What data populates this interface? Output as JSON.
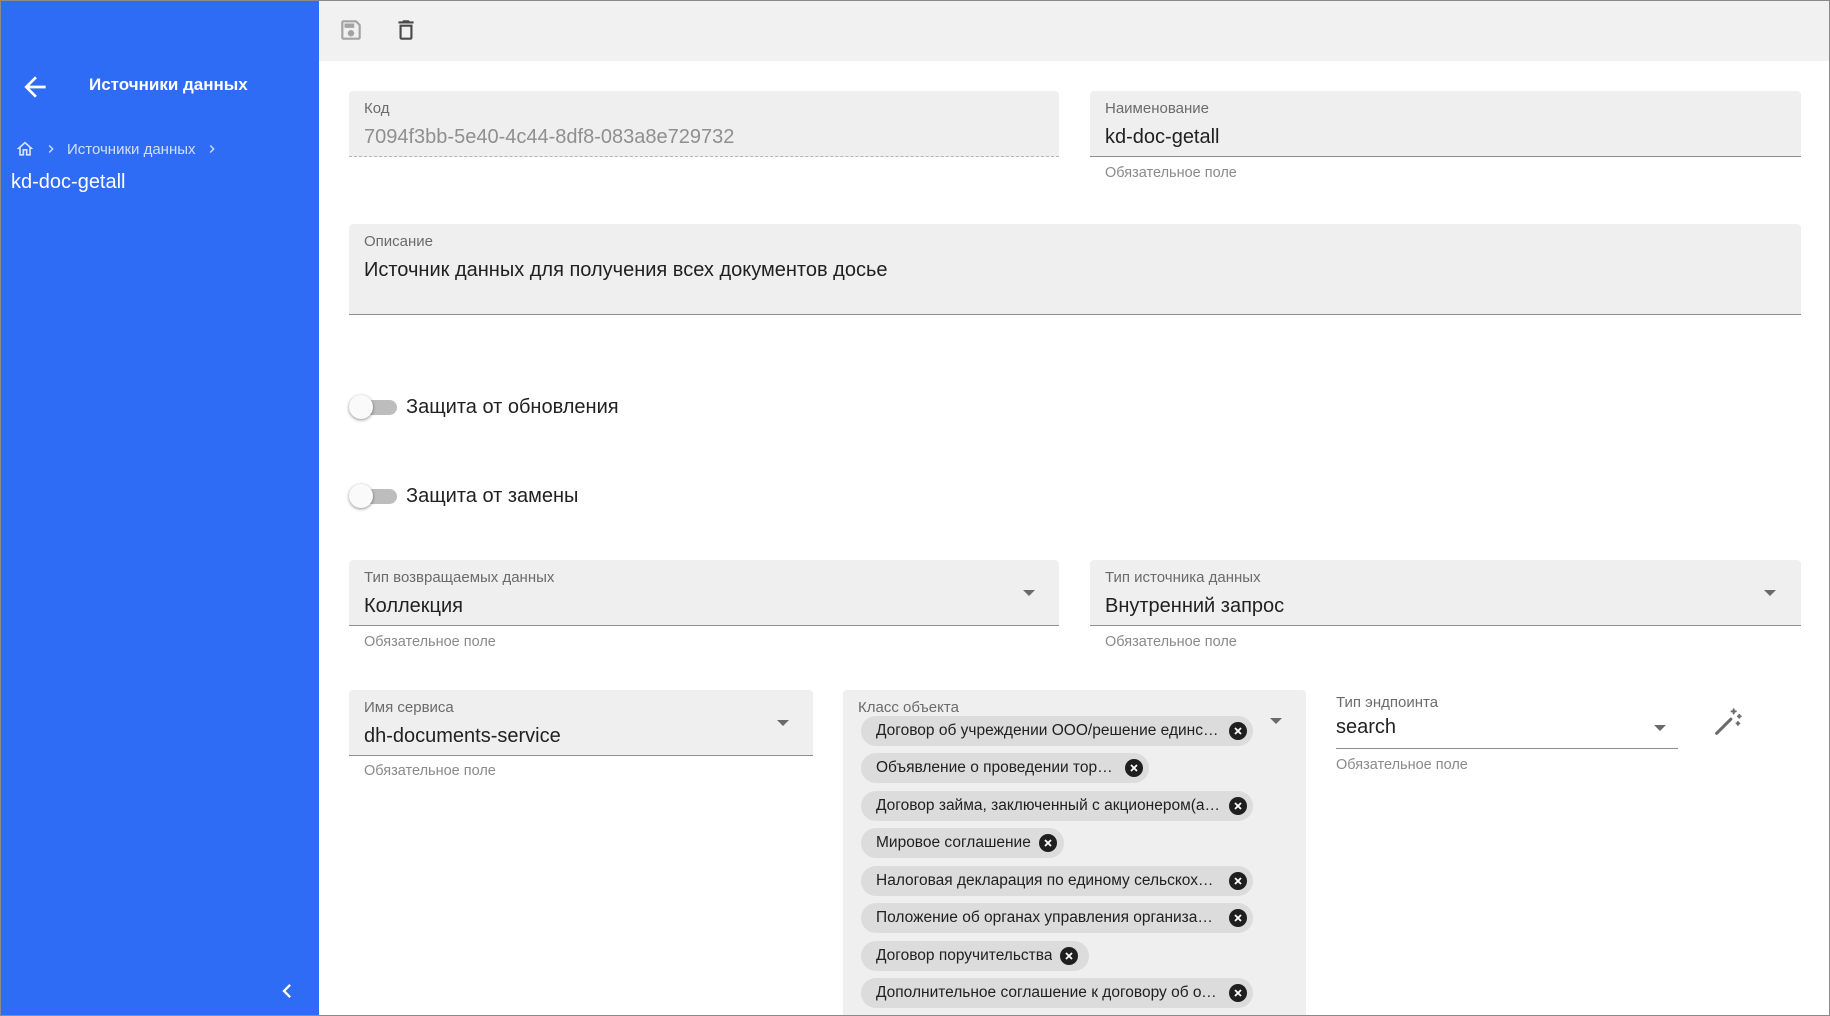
{
  "sidebar": {
    "title": "Источники данных",
    "breadcrumb": {
      "home_icon": "home-icon",
      "item": "Источники данных"
    },
    "current": "kd-doc-getall",
    "accent_color": "#2f6cf5"
  },
  "toolbar": {
    "save_icon": "save-icon",
    "delete_icon": "delete-icon"
  },
  "form": {
    "code": {
      "label": "Код",
      "value": "7094f3bb-5e40-4c44-8df8-083a8e729732"
    },
    "name": {
      "label": "Наименование",
      "value": "kd-doc-getall",
      "hint": "Обязательное поле"
    },
    "description": {
      "label": "Описание",
      "value": "Источник данных для получения всех документов досье"
    },
    "update_protection": {
      "label": "Защита от обновления",
      "checked": false
    },
    "replace_protection": {
      "label": "Защита от замены",
      "checked": false
    },
    "return_type": {
      "label": "Тип возвращаемых данных",
      "value": "Коллекция",
      "hint": "Обязательное поле"
    },
    "source_type": {
      "label": "Тип источника данных",
      "value": "Внутренний запрос",
      "hint": "Обязательное поле"
    },
    "service_name": {
      "label": "Имя сервиса",
      "value": "dh-documents-service",
      "hint": "Обязательное поле"
    },
    "object_class": {
      "label": "Класс объекта",
      "chips": [
        "Договор об учреждении ООО/решение единственного учредителя",
        "Объявление о проведении торгов",
        "Договор займа, заключенный с акционером(акционерами)",
        "Мировое соглашение",
        "Налоговая декларация по единому сельскохозяйственному налогу",
        "Положение об органах управления организации",
        "Договор поручительства",
        "Дополнительное соглашение к договору об открытии"
      ]
    },
    "endpoint_type": {
      "label": "Тип эндпоинта",
      "value": "search",
      "hint": "Обязательное поле"
    }
  }
}
